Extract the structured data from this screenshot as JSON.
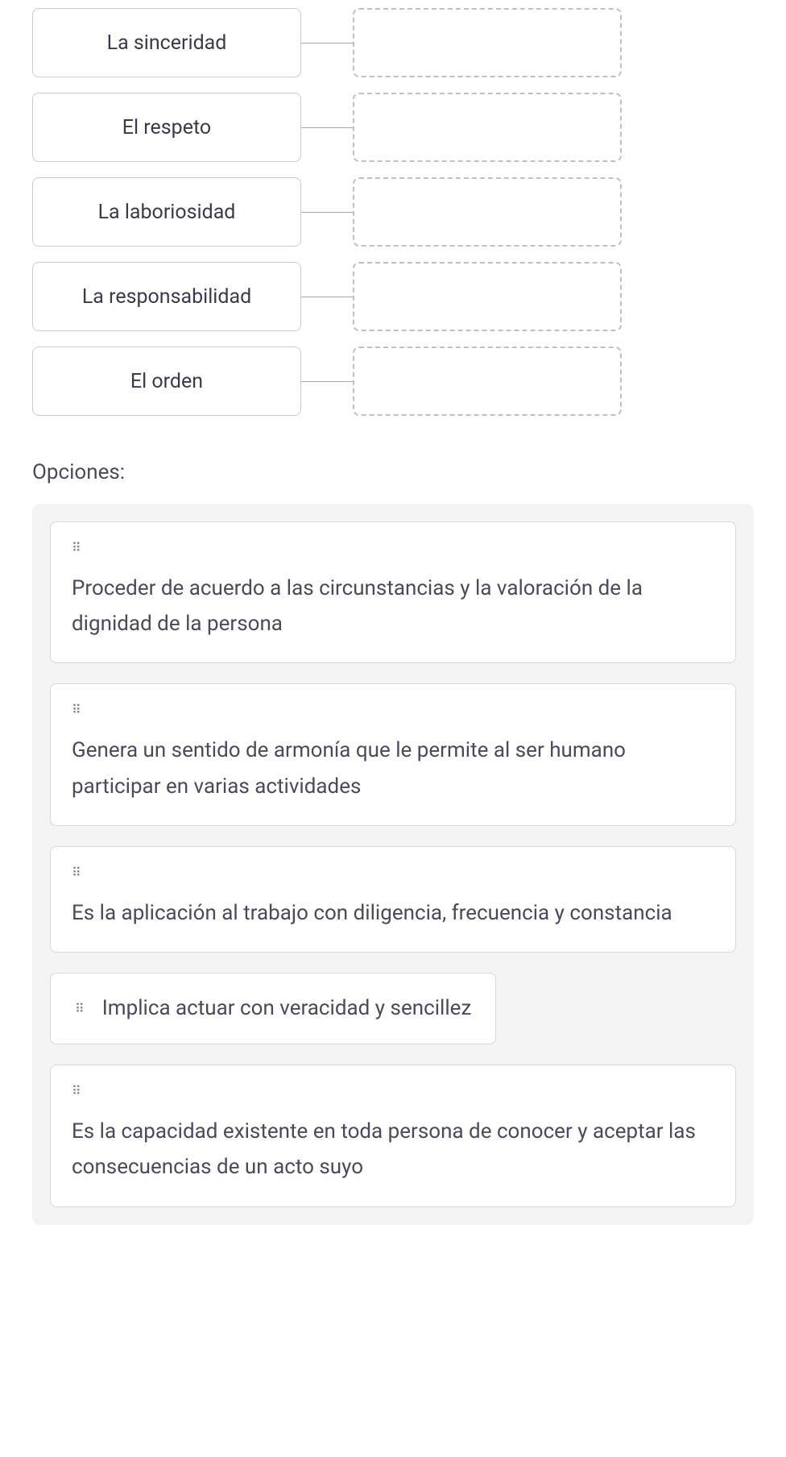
{
  "matching": {
    "items": [
      {
        "label": "La sinceridad"
      },
      {
        "label": "El respeto"
      },
      {
        "label": "La laboriosidad"
      },
      {
        "label": "La responsabilidad"
      },
      {
        "label": "El orden"
      }
    ]
  },
  "options_title": "Opciones:",
  "options": [
    {
      "text": "Proceder de acuerdo a las circunstancias y la valoración de la dignidad de la persona",
      "inline": false
    },
    {
      "text": "Genera un sentido de armonía que le permite al ser humano participar en varias actividades",
      "inline": false
    },
    {
      "text": "Es la aplicación al trabajo con diligencia, frecuencia y constancia",
      "inline": false
    },
    {
      "text": "Implica actuar con veracidad y sencillez",
      "inline": true
    },
    {
      "text": "Es la capacidad existente en toda persona de conocer y aceptar las consecuencias de un acto suyo",
      "inline": false
    }
  ]
}
